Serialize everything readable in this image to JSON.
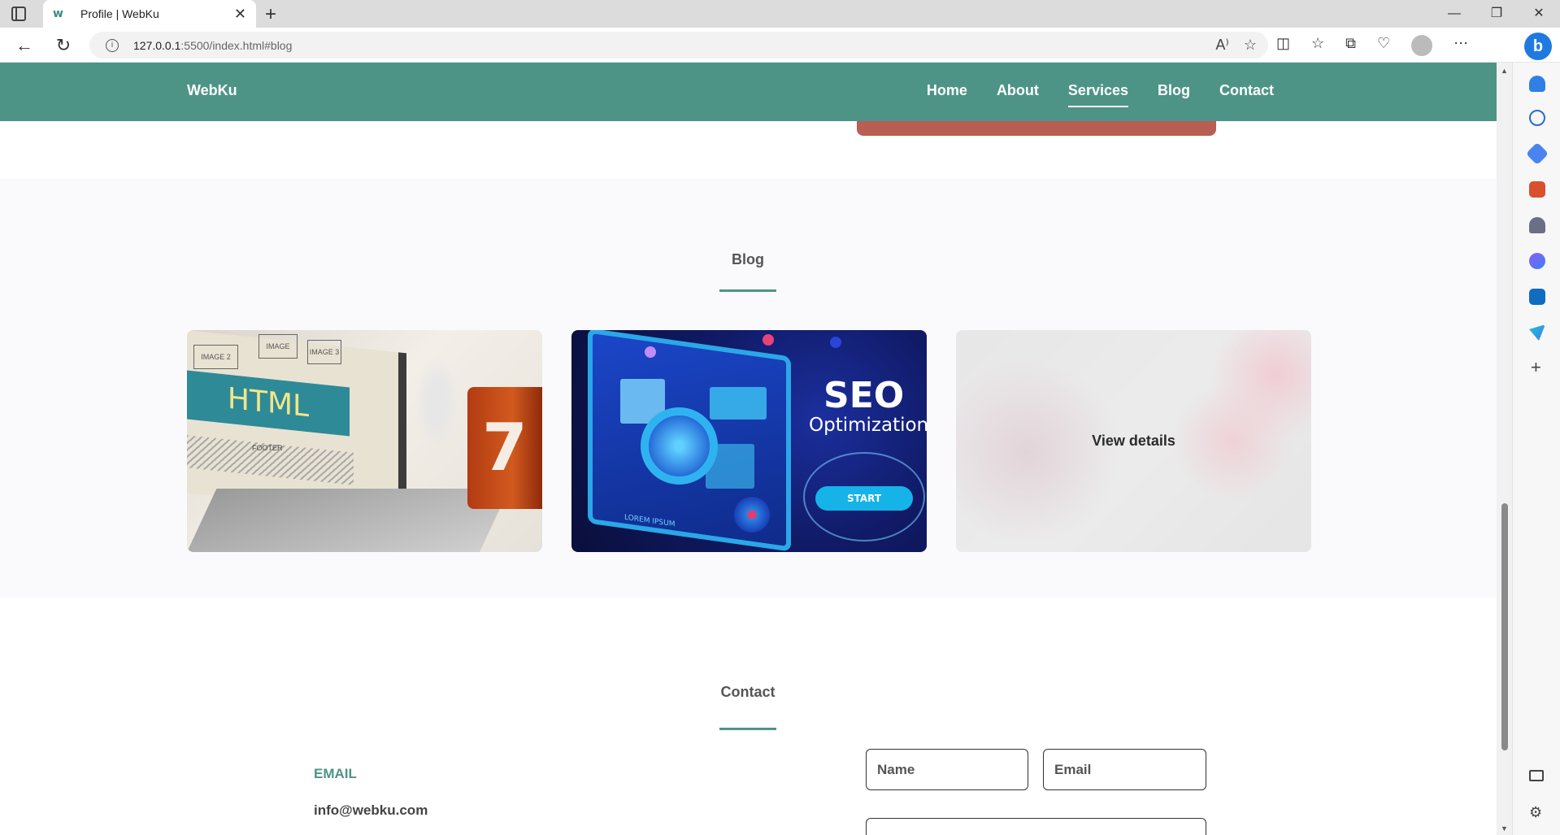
{
  "browser": {
    "tab_title": "Profile | WebKu",
    "url_host": "127.0.0.1",
    "url_path": ":5500/index.html#blog"
  },
  "site": {
    "brand": "WebKu",
    "nav": [
      {
        "label": "Home",
        "active": false
      },
      {
        "label": "About",
        "active": false
      },
      {
        "label": "Services",
        "active": true
      },
      {
        "label": "Blog",
        "active": false
      },
      {
        "label": "Contact",
        "active": false
      }
    ]
  },
  "blog": {
    "title": "Blog",
    "cards": [
      {
        "image": "html-laptop",
        "sketch_labels": [
          "IMAGE 2",
          "IMAGE",
          "IMAGE 3"
        ],
        "screen_text": "HTML",
        "footer_sketch": "FOOTER",
        "mug_number": "7"
      },
      {
        "image": "seo-optimization",
        "headline": "SEO",
        "subline": "Optimization",
        "button": "START",
        "lorem": "LOREM IPSUM"
      },
      {
        "image": "blurred",
        "overlay_label": "View details"
      }
    ]
  },
  "contact": {
    "title": "Contact",
    "email_label": "EMAIL",
    "email_value": "info@webku.com",
    "name_placeholder": "Name",
    "email_placeholder": "Email"
  },
  "colors": {
    "header": "#4d9487",
    "accent": "#4d9487",
    "red_button": "#b85e52"
  }
}
